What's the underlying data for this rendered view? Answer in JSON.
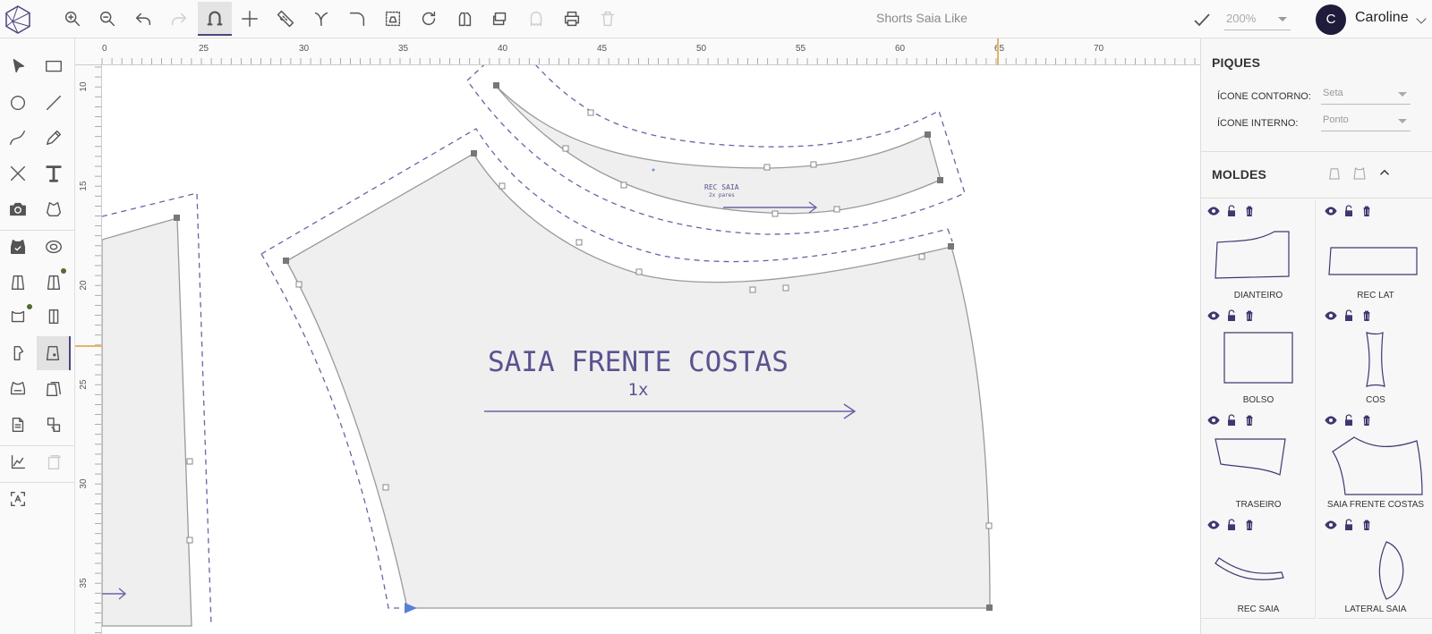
{
  "app": {
    "title": "Shorts Saia Like"
  },
  "toolbar": {
    "items": [
      {
        "icon": "zoom-in-icon"
      },
      {
        "icon": "zoom-out-icon"
      },
      {
        "icon": "undo-icon"
      },
      {
        "icon": "redo-icon",
        "disabled": true
      },
      {
        "icon": "magnet-icon",
        "active": true
      },
      {
        "icon": "crosshair-icon"
      },
      {
        "icon": "ruler-measure-icon"
      },
      {
        "icon": "angle-tool-icon"
      },
      {
        "icon": "curve-corner-icon"
      },
      {
        "icon": "frame-select-icon"
      },
      {
        "icon": "rotate-icon"
      },
      {
        "icon": "mirror-piece-icon"
      },
      {
        "icon": "layers-icon"
      },
      {
        "icon": "ghost-icon",
        "disabled": true
      },
      {
        "icon": "print-icon"
      },
      {
        "icon": "trash-icon",
        "disabled": true
      }
    ],
    "zoom": "200%"
  },
  "user": {
    "initial": "C",
    "name": "Caroline"
  },
  "left_tools": [
    {
      "icon": "pointer-arrow-icon"
    },
    {
      "icon": "rectangle-icon"
    },
    {
      "icon": "circle-icon"
    },
    {
      "icon": "line-icon"
    },
    {
      "icon": "curve-icon"
    },
    {
      "icon": "pencil-icon"
    },
    {
      "icon": "close-x-icon"
    },
    {
      "icon": "text-t-icon"
    },
    {
      "icon": "camera-icon"
    },
    {
      "icon": "garment-scan-icon"
    },
    {
      "icon": "garment-check-icon"
    },
    {
      "icon": "tape-measure-icon"
    },
    {
      "icon": "piece-front-icon"
    },
    {
      "icon": "piece-back-icon"
    },
    {
      "icon": "piece-top-icon"
    },
    {
      "icon": "piece-split-icon"
    },
    {
      "icon": "sleeve-icon"
    },
    {
      "icon": "piece-pocket-icon",
      "active": true
    },
    {
      "icon": "piece-grade-icon"
    },
    {
      "icon": "piece-layers-icon"
    },
    {
      "icon": "document-copy-icon"
    },
    {
      "icon": "document-convert-icon"
    },
    {
      "icon": "graph-axis-icon"
    },
    {
      "icon": "export-icon",
      "disabled": true
    },
    {
      "icon": "text-recognition-icon"
    }
  ],
  "rulers": {
    "top_labels": [
      "0",
      "25",
      "30",
      "35",
      "40",
      "45",
      "50",
      "55",
      "60",
      "65",
      "70"
    ],
    "left_labels": [
      "10",
      "15",
      "20",
      "25",
      "30",
      "35"
    ]
  },
  "canvas": {
    "main_piece": {
      "name": "SAIA FRENTE COSTAS",
      "quantity": "1x"
    },
    "small_piece": {
      "name": "REC SAIA",
      "quantity": "2x pares"
    },
    "colors": {
      "outline": "#9a9a9a",
      "seam": "#6a63a6",
      "fill": "#efefef",
      "text": "#5a5390"
    }
  },
  "panel": {
    "piques": {
      "title": "PIQUES",
      "contorno_label": "ÍCONE CONTORNO:",
      "contorno_value": "Seta",
      "interno_label": "ÍCONE INTERNO:",
      "interno_value": "Ponto"
    },
    "moldes": {
      "title": "MOLDES",
      "items": [
        {
          "label": "DIANTEIRO"
        },
        {
          "label": "REC LAT"
        },
        {
          "label": "BOLSO"
        },
        {
          "label": "CÓS"
        },
        {
          "label": "TRASEIRO"
        },
        {
          "label": "SAIA FRENTE COSTAS"
        },
        {
          "label": "REC SAIA"
        },
        {
          "label": "LATERAL SAIA"
        }
      ]
    }
  }
}
